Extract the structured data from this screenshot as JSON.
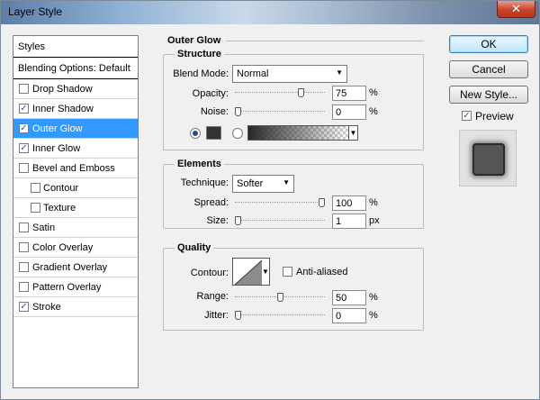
{
  "window": {
    "title": "Layer Style",
    "close_label": "✕"
  },
  "styles_panel": {
    "header": "Styles",
    "blending": "Blending Options: Default",
    "items": [
      {
        "label": "Drop Shadow",
        "checked": false,
        "selected": false,
        "sub": false
      },
      {
        "label": "Inner Shadow",
        "checked": true,
        "selected": false,
        "sub": false
      },
      {
        "label": "Outer Glow",
        "checked": true,
        "selected": true,
        "sub": false
      },
      {
        "label": "Inner Glow",
        "checked": true,
        "selected": false,
        "sub": false
      },
      {
        "label": "Bevel and Emboss",
        "checked": false,
        "selected": false,
        "sub": false
      },
      {
        "label": "Contour",
        "checked": false,
        "selected": false,
        "sub": true
      },
      {
        "label": "Texture",
        "checked": false,
        "selected": false,
        "sub": true
      },
      {
        "label": "Satin",
        "checked": false,
        "selected": false,
        "sub": false
      },
      {
        "label": "Color Overlay",
        "checked": false,
        "selected": false,
        "sub": false
      },
      {
        "label": "Gradient Overlay",
        "checked": false,
        "selected": false,
        "sub": false
      },
      {
        "label": "Pattern Overlay",
        "checked": false,
        "selected": false,
        "sub": false
      },
      {
        "label": "Stroke",
        "checked": true,
        "selected": false,
        "sub": false
      }
    ]
  },
  "outer_glow": {
    "title": "Outer Glow",
    "structure": {
      "title": "Structure",
      "blend_mode_label": "Blend Mode:",
      "blend_mode_value": "Normal",
      "opacity_label": "Opacity:",
      "opacity_value": "75",
      "opacity_level": 75,
      "opacity_unit": "%",
      "noise_label": "Noise:",
      "noise_value": "0",
      "noise_level": 0,
      "noise_unit": "%",
      "glow_color": "#333333",
      "color_mode": "solid"
    },
    "elements": {
      "title": "Elements",
      "technique_label": "Technique:",
      "technique_value": "Softer",
      "spread_label": "Spread:",
      "spread_value": "100",
      "spread_level": 100,
      "spread_unit": "%",
      "size_label": "Size:",
      "size_value": "1",
      "size_level": 0,
      "size_unit": "px"
    },
    "quality": {
      "title": "Quality",
      "contour_label": "Contour:",
      "anti_aliased_label": "Anti-aliased",
      "anti_aliased": false,
      "range_label": "Range:",
      "range_value": "50",
      "range_level": 50,
      "range_unit": "%",
      "jitter_label": "Jitter:",
      "jitter_value": "0",
      "jitter_level": 0,
      "jitter_unit": "%"
    }
  },
  "buttons": {
    "ok": "OK",
    "cancel": "Cancel",
    "new_style": "New Style...",
    "preview_label": "Preview",
    "preview_checked": true
  },
  "icons": {
    "dropdown": "chevron-down-icon",
    "checkmark": "check-icon"
  }
}
